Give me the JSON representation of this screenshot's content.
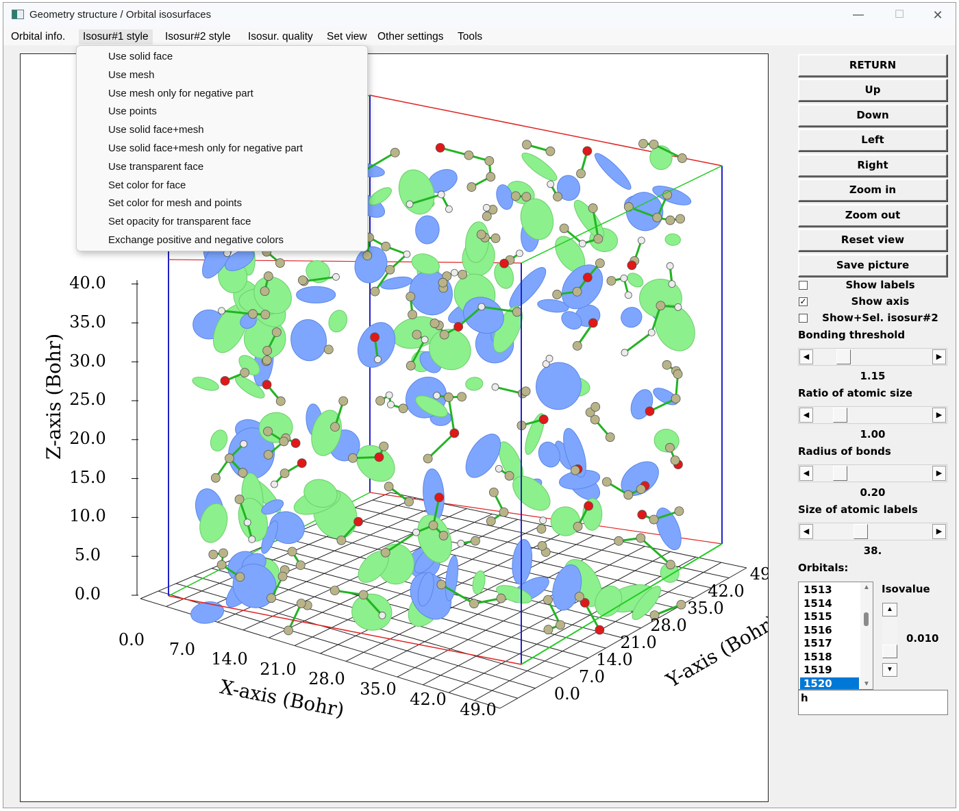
{
  "window": {
    "title": "Geometry structure / Orbital isosurfaces",
    "controls": {
      "minimize": "—",
      "maximize": "☐",
      "close": "✕"
    }
  },
  "menubar": {
    "items": [
      {
        "label": "Orbital info."
      },
      {
        "label": "Isosur#1 style",
        "active": true
      },
      {
        "label": "Isosur#2 style"
      },
      {
        "label": "Isosur. quality"
      },
      {
        "label": "Set view"
      },
      {
        "label": "Other settings"
      },
      {
        "label": "Tools"
      }
    ]
  },
  "dropdown": {
    "items": [
      "Use solid face",
      "Use mesh",
      "Use mesh only for negative part",
      "Use points",
      "Use solid face+mesh",
      "Use solid face+mesh only for negative part",
      "Use transparent face",
      "Set color for face",
      "Set color for mesh and points",
      "Set opacity for transparent face",
      "Exchange positive and negative colors"
    ]
  },
  "plot": {
    "z_axis_title": "Z-axis (Bohr)",
    "x_axis_title": "X-axis (Bohr)",
    "y_axis_title": "Y-axis (Bohr)",
    "z_ticks": [
      "0.0",
      "5.0",
      "10.0",
      "15.0",
      "20.0",
      "25.0",
      "30.0",
      "35.0",
      "40.0"
    ],
    "x_ticks": [
      "0.0",
      "7.0",
      "14.0",
      "21.0",
      "28.0",
      "35.0",
      "42.0",
      "49.0"
    ],
    "y_ticks": [
      "0.0",
      "7.0",
      "14.0",
      "21.0",
      "28.0",
      "35.0",
      "42.0",
      "49"
    ],
    "colors": {
      "positive_isosurface": "#8cf08c",
      "negative_isosurface": "#7ea6ff",
      "bond": "#22b422",
      "carbon_atom": "#b8b488",
      "oxygen_atom": "#e01818",
      "hydrogen_atom": "#ececec",
      "box_x_edge": "#e02020",
      "box_y_edge": "#22cc22",
      "box_z_edge": "#2020c8"
    }
  },
  "panel": {
    "buttons": [
      "RETURN",
      "Up",
      "Down",
      "Left",
      "Right",
      "Zoom in",
      "Zoom out",
      "Reset view",
      "Save picture"
    ],
    "checkboxes": [
      {
        "label": "Show labels",
        "checked": false
      },
      {
        "label": "Show axis",
        "checked": true
      },
      {
        "label": "Show+Sel. isosur#2",
        "checked": false
      }
    ],
    "sliders": [
      {
        "label": "Bonding threshold",
        "value": "1.15"
      },
      {
        "label": "Ratio of atomic size",
        "value": "1.00"
      },
      {
        "label": "Radius of bonds",
        "value": "0.20"
      },
      {
        "label": "Size of atomic labels",
        "value": "38."
      }
    ],
    "orbitals_label": "Orbitals:",
    "orbitals": [
      "1513",
      "1514",
      "1515",
      "1516",
      "1517",
      "1518",
      "1519",
      "1520"
    ],
    "selected_orbital": "1520",
    "isovalue_label": "Isovalue",
    "isovalue": "0.010",
    "text_input": "h"
  }
}
